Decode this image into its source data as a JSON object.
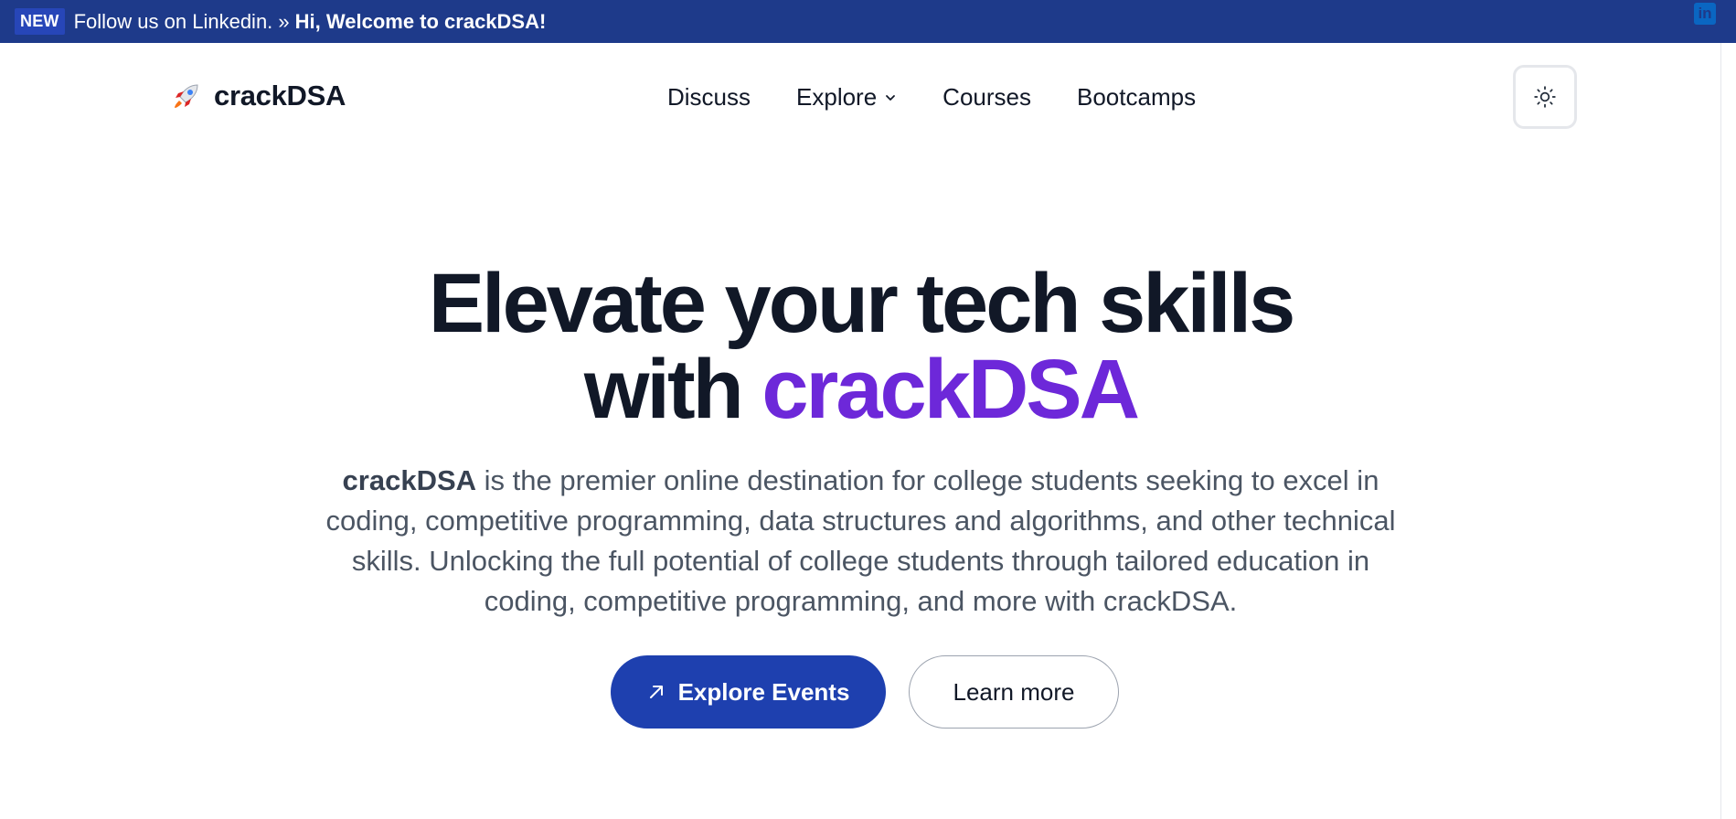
{
  "announcement": {
    "badge": "NEW",
    "follow_text": "Follow us on Linkedin. »",
    "welcome_text": "Hi, Welcome to crackDSA!",
    "linkedin_label": "in"
  },
  "header": {
    "logo_text": "crackDSA",
    "nav": [
      {
        "label": "Discuss"
      },
      {
        "label": "Explore"
      },
      {
        "label": "Courses"
      },
      {
        "label": "Bootcamps"
      }
    ],
    "theme_toggle_icon": "sun-icon"
  },
  "hero": {
    "title_line1": "Elevate your tech skills",
    "title_line2_prefix": "with ",
    "title_line2_accent": "crackDSA",
    "desc_brand": "crackDSA",
    "desc_text": " is the premier online destination for college students seeking to excel in coding, competitive programming, data structures and algorithms, and other technical skills. Unlocking the full potential of college students through tailored education in coding, competitive programming, and more with crackDSA.",
    "primary_button": "Explore Events",
    "secondary_button": "Learn more"
  },
  "colors": {
    "topbar": "#1e3a8a",
    "accent_purple": "#6d28d9",
    "primary_button": "#1e40af"
  }
}
